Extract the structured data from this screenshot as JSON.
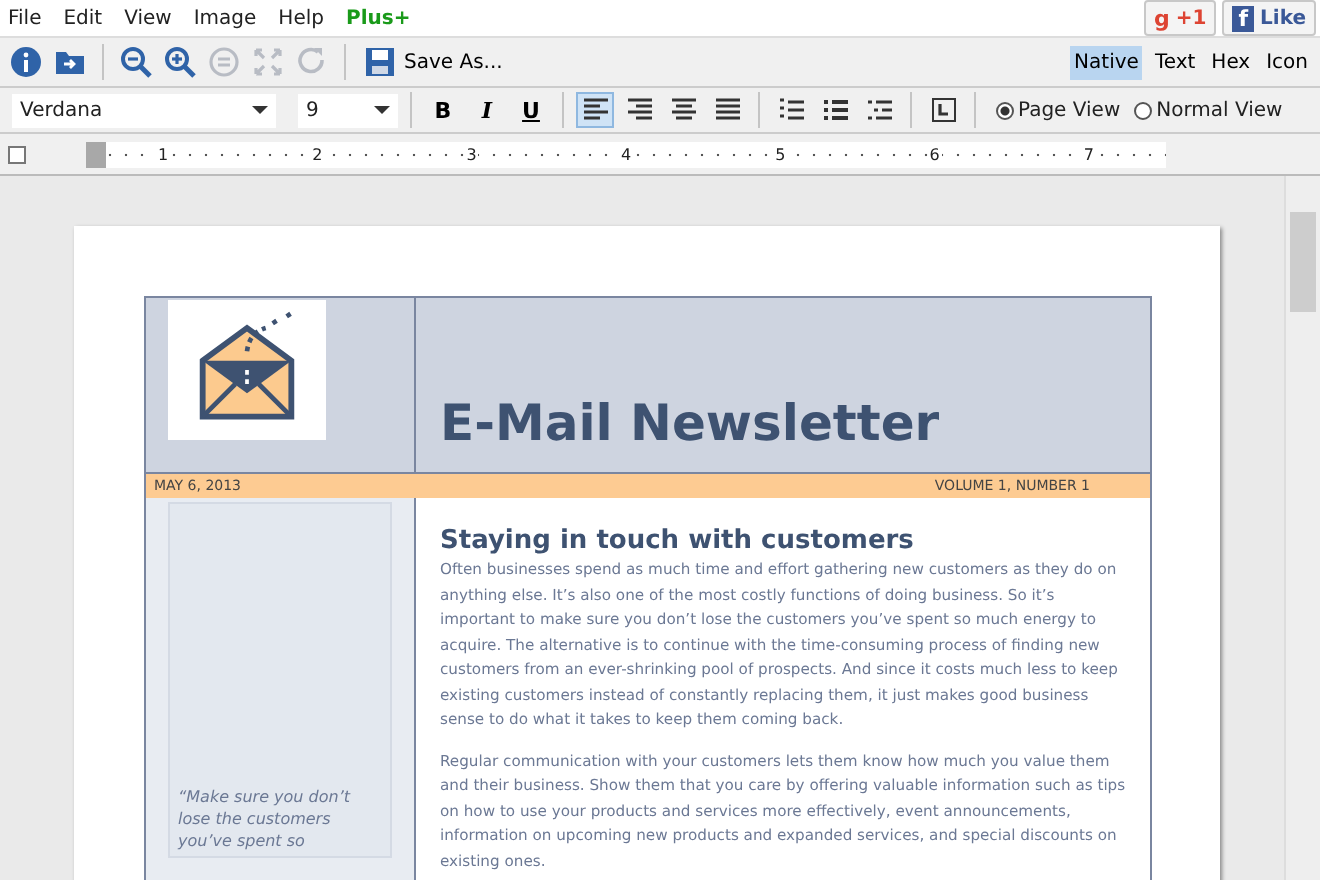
{
  "menu": {
    "items": [
      "File",
      "Edit",
      "View",
      "Image",
      "Help"
    ],
    "plus": "Plus+"
  },
  "social": [
    {
      "kind": "gplus",
      "icon": "g",
      "label": "+1"
    },
    {
      "kind": "facebook",
      "icon": "f",
      "label": "Like"
    }
  ],
  "toolbar": {
    "tools": [
      {
        "kind": "info",
        "disabled": false
      },
      {
        "kind": "open",
        "disabled": false
      },
      {
        "kind": "zoom-out",
        "disabled": false
      },
      {
        "kind": "zoom-in",
        "disabled": false
      },
      {
        "kind": "zoom-reset",
        "disabled": true
      },
      {
        "kind": "fit",
        "disabled": true
      },
      {
        "kind": "redo",
        "disabled": true
      }
    ],
    "save_as": "Save As...",
    "views": [
      {
        "label": "Native",
        "selected": true
      },
      {
        "label": "Text",
        "selected": false
      },
      {
        "label": "Hex",
        "selected": false
      },
      {
        "label": "Icon",
        "selected": false
      }
    ]
  },
  "format_bar": {
    "font": "Verdana",
    "size": "9",
    "buttons": [
      {
        "kind": "bold",
        "label": "B",
        "selected": false
      },
      {
        "kind": "italic",
        "label": "I",
        "selected": false
      },
      {
        "kind": "underline",
        "label": "U",
        "selected": false
      },
      {
        "kind": "align-left",
        "selected": true
      },
      {
        "kind": "align-right",
        "selected": false
      },
      {
        "kind": "align-center",
        "selected": false
      },
      {
        "kind": "justify",
        "selected": false
      },
      {
        "kind": "numbered-list",
        "selected": false
      },
      {
        "kind": "bullet-list",
        "selected": false
      },
      {
        "kind": "multilevel-list",
        "selected": false
      },
      {
        "kind": "style",
        "selected": false
      }
    ],
    "page_modes": [
      {
        "label": "Page View",
        "selected": true
      },
      {
        "label": "Normal View",
        "selected": false
      }
    ]
  },
  "ruler": {
    "numbers": [
      "1",
      "2",
      "3",
      "4",
      "5",
      "6",
      "7"
    ]
  },
  "document": {
    "title": "E-Mail Newsletter",
    "date": "MAY 6, 2013",
    "issue": "VOLUME 1, NUMBER 1",
    "heading": "Staying in touch with customers",
    "paragraphs": [
      "Often businesses spend as much time and effort gathering new customers as they do on anything else. It’s also one of the most costly functions of doing business. So it’s important to make sure you don’t lose the customers you’ve spent so much energy to acquire. The alternative is to continue with the time-consuming process of finding new customers from an ever-shrinking pool of prospects. And since it costs much less to keep existing customers instead of constantly replacing them, it just makes good business sense to do what it takes to keep them coming back.",
      "Regular communication with your customers lets them know how much you value them and their business. Show them that you care by offering valuable information such as tips on how to use your products and services more effectively, event announcements, information on upcoming new products and expanded services, and special discounts on existing ones."
    ],
    "quote": "“Make sure you don’t lose the customers you’ve spent so"
  }
}
